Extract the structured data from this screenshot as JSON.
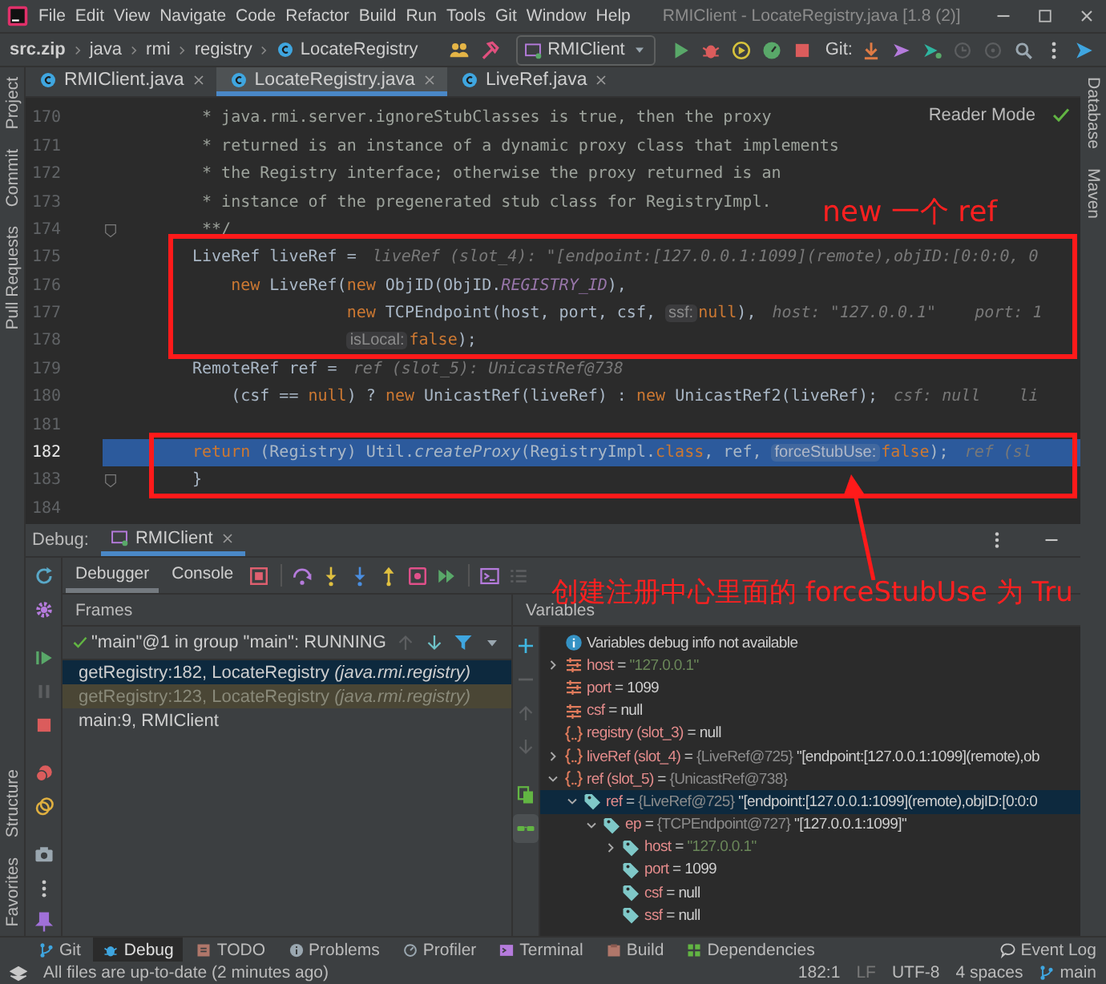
{
  "window": {
    "title": "RMIClient - LocateRegistry.java [1.8 (2)]"
  },
  "menu": [
    "File",
    "Edit",
    "View",
    "Navigate",
    "Code",
    "Refactor",
    "Build",
    "Run",
    "Tools",
    "Git",
    "Window",
    "Help"
  ],
  "breadcrumbs": [
    {
      "text": "src.zip",
      "kind": "archive"
    },
    {
      "text": "java",
      "kind": "package"
    },
    {
      "text": "rmi",
      "kind": "package"
    },
    {
      "text": "registry",
      "kind": "package"
    },
    {
      "text": "LocateRegistry",
      "kind": "class"
    }
  ],
  "toolbar": [
    {
      "kind": "users",
      "disabled": false
    },
    {
      "kind": "hammer",
      "disabled": false
    },
    {
      "kind": "run-config",
      "label": "RMIClient"
    },
    {
      "kind": "run",
      "disabled": false
    },
    {
      "kind": "debug",
      "disabled": false
    },
    {
      "kind": "coverage",
      "disabled": false
    },
    {
      "kind": "profiler",
      "disabled": false
    },
    {
      "kind": "stop",
      "disabled": false
    },
    {
      "kind": "git-label",
      "label": "Git:"
    },
    {
      "kind": "update",
      "disabled": false
    },
    {
      "kind": "push",
      "disabled": false
    },
    {
      "kind": "commit",
      "disabled": false
    },
    {
      "kind": "history",
      "disabled": true
    },
    {
      "kind": "rollback",
      "disabled": true
    },
    {
      "kind": "search",
      "disabled": false
    },
    {
      "kind": "more",
      "disabled": false
    },
    {
      "kind": "plugin",
      "disabled": false
    }
  ],
  "left_stripe": {
    "top": [
      "Project",
      "Commit",
      "Pull Requests"
    ],
    "bottom": [
      "Structure",
      "Favorites"
    ]
  },
  "right_stripe": [
    "Database",
    "Maven"
  ],
  "editor_tabs": [
    {
      "label": "RMIClient.java",
      "selected": false
    },
    {
      "label": "LocateRegistry.java",
      "selected": true
    },
    {
      "label": "LiveRef.java",
      "selected": false
    }
  ],
  "reader_mode": "Reader Mode",
  "code_lines": [
    {
      "number": "170",
      "kind": "statement",
      "current": false,
      "fold": false,
      "segments": [
        {
          "kind": "code",
          "parts": [
            {
              "kind": "comment",
              "text": " * java.rmi.server.ignoreStubClasses is true, then the proxy"
            }
          ]
        }
      ]
    },
    {
      "number": "171",
      "kind": "statement",
      "current": false,
      "fold": false,
      "segments": [
        {
          "kind": "code",
          "parts": [
            {
              "kind": "comment",
              "text": " * returned is an instance of a dynamic proxy class that implements"
            }
          ]
        }
      ]
    },
    {
      "number": "172",
      "kind": "statement",
      "current": false,
      "fold": false,
      "segments": [
        {
          "kind": "code",
          "parts": [
            {
              "kind": "comment",
              "text": " * the Registry interface; otherwise the proxy returned is an"
            }
          ]
        }
      ]
    },
    {
      "number": "173",
      "kind": "statement",
      "current": false,
      "fold": false,
      "segments": [
        {
          "kind": "code",
          "parts": [
            {
              "kind": "comment",
              "text": " * instance of the pregenerated stub class for RegistryImpl."
            }
          ]
        }
      ]
    },
    {
      "number": "174",
      "kind": "statement",
      "current": false,
      "fold": true,
      "segments": [
        {
          "kind": "code",
          "parts": [
            {
              "kind": "comment",
              "text": " **/"
            }
          ]
        }
      ]
    },
    {
      "number": "175",
      "kind": "statement",
      "current": false,
      "fold": false,
      "segments": [
        {
          "kind": "code",
          "parts": [
            {
              "kind": "plain",
              "text": "LiveRef liveRef ="
            }
          ]
        },
        {
          "kind": "hint",
          "text": "liveRef (slot_4): \"[endpoint:[127.0.0.1:1099](remote),objID:[0:0:0, 0"
        }
      ]
    },
    {
      "number": "176",
      "kind": "continuation",
      "current": false,
      "fold": false,
      "segments": [
        {
          "kind": "code",
          "parts": [
            {
              "kind": "keyword",
              "text": "new"
            },
            {
              "kind": "plain",
              "text": " LiveRef("
            },
            {
              "kind": "keyword",
              "text": "new"
            },
            {
              "kind": "plain",
              "text": " ObjID(ObjID."
            },
            {
              "kind": "static",
              "text": "REGISTRY_ID"
            },
            {
              "kind": "plain",
              "text": "),"
            }
          ]
        }
      ]
    },
    {
      "number": "177",
      "kind": "argument",
      "current": false,
      "fold": false,
      "segments": [
        {
          "kind": "code",
          "parts": [
            {
              "kind": "keyword",
              "text": "new"
            },
            {
              "kind": "plain",
              "text": " TCPEndpoint(host, port, csf, "
            }
          ]
        },
        {
          "kind": "inlay",
          "text": "ssf:"
        },
        {
          "kind": "code",
          "parts": [
            {
              "kind": "keyword",
              "text": "null"
            },
            {
              "kind": "plain",
              "text": "),"
            }
          ]
        },
        {
          "kind": "hint",
          "text": "host: \"127.0.0.1\"    port: 1"
        }
      ]
    },
    {
      "number": "178",
      "kind": "argument",
      "current": false,
      "fold": false,
      "segments": [
        {
          "kind": "inlay",
          "text": "isLocal:"
        },
        {
          "kind": "code",
          "parts": [
            {
              "kind": "keyword",
              "text": "false"
            },
            {
              "kind": "plain",
              "text": ");"
            }
          ]
        }
      ]
    },
    {
      "number": "179",
      "kind": "statement",
      "current": false,
      "fold": false,
      "segments": [
        {
          "kind": "code",
          "parts": [
            {
              "kind": "plain",
              "text": "RemoteRef ref ="
            }
          ]
        },
        {
          "kind": "hint",
          "text": "ref (slot_5): UnicastRef@738"
        }
      ]
    },
    {
      "number": "180",
      "kind": "continuation",
      "current": false,
      "fold": false,
      "segments": [
        {
          "kind": "code",
          "parts": [
            {
              "kind": "plain",
              "text": "(csf == "
            },
            {
              "kind": "keyword",
              "text": "null"
            },
            {
              "kind": "plain",
              "text": ") ? "
            },
            {
              "kind": "keyword",
              "text": "new"
            },
            {
              "kind": "plain",
              "text": " UnicastRef(liveRef) : "
            },
            {
              "kind": "keyword",
              "text": "new"
            },
            {
              "kind": "plain",
              "text": " UnicastRef2(liveRef);"
            }
          ]
        },
        {
          "kind": "hint",
          "text": "csf: null    li"
        }
      ]
    },
    {
      "number": "181",
      "kind": "statement",
      "current": false,
      "fold": false
    },
    {
      "number": "182",
      "kind": "statement",
      "current": true,
      "fold": false,
      "segments": [
        {
          "kind": "code",
          "parts": [
            {
              "kind": "keyword",
              "text": "return"
            },
            {
              "kind": "plain",
              "text": " (Registry) Util."
            },
            {
              "kind": "method",
              "text": "createProxy"
            },
            {
              "kind": "plain",
              "text": "(RegistryImpl."
            },
            {
              "kind": "keyword",
              "text": "class"
            },
            {
              "kind": "plain",
              "text": ", ref, "
            }
          ]
        },
        {
          "kind": "inlay",
          "text": "forceStubUse:"
        },
        {
          "kind": "code",
          "parts": [
            {
              "kind": "keyword",
              "text": "false"
            },
            {
              "kind": "plain",
              "text": ");"
            }
          ]
        },
        {
          "kind": "hint",
          "text": "ref (sl"
        }
      ]
    },
    {
      "number": "183",
      "kind": "statement",
      "current": false,
      "fold": true,
      "segments": [
        {
          "kind": "code",
          "parts": [
            {
              "kind": "plain",
              "text": "}"
            }
          ]
        }
      ]
    },
    {
      "number": "184",
      "kind": "statement",
      "current": false,
      "fold": false
    }
  ],
  "annotations": [
    {
      "text": "new 一个 ref"
    },
    {
      "text": "创建注册中心里面的 forceStubUse 为 Tru"
    }
  ],
  "debug": {
    "label": "Debug:",
    "session_tab": "RMIClient",
    "left_tools": [
      {
        "kind": "rerun",
        "disabled": false
      },
      {
        "kind": "settings",
        "disabled": false
      },
      {
        "kind": "resume",
        "disabled": false
      },
      {
        "kind": "pause",
        "disabled": true
      },
      {
        "kind": "stop",
        "disabled": false
      },
      {
        "kind": "breakpoints",
        "disabled": false
      },
      {
        "kind": "mute",
        "disabled": false
      },
      {
        "kind": "camera",
        "disabled": false
      },
      {
        "kind": "more-v",
        "disabled": false
      },
      {
        "kind": "pin",
        "disabled": false
      }
    ],
    "tabs": [
      {
        "label": "Debugger",
        "selected": true
      },
      {
        "label": "Console",
        "selected": false
      }
    ],
    "toolbar": [
      {
        "kind": "layout",
        "disabled": false
      },
      {
        "kind": "step-over",
        "disabled": false
      },
      {
        "kind": "step-into",
        "disabled": false
      },
      {
        "kind": "force-step-into",
        "disabled": false
      },
      {
        "kind": "step-out",
        "disabled": false
      },
      {
        "kind": "drop-frame",
        "disabled": false
      },
      {
        "kind": "run-to-cursor",
        "disabled": false
      },
      {
        "kind": "evaluate",
        "disabled": false
      },
      {
        "kind": "trace",
        "disabled": true
      }
    ],
    "frames": {
      "title": "Frames",
      "thread": "\"main\"@1 in group \"main\": RUNNING",
      "thread_tools": [
        {
          "kind": "up",
          "disabled": true
        },
        {
          "kind": "down",
          "disabled": false
        },
        {
          "kind": "filter",
          "disabled": false
        },
        {
          "kind": "caret",
          "disabled": false
        }
      ],
      "items": [
        {
          "text": "getRegistry:182, LocateRegistry *(java.rmi.registry)*",
          "selected": true,
          "library": false
        },
        {
          "text": "getRegistry:123, LocateRegistry *(java.rmi.registry)*",
          "selected": false,
          "library": true
        },
        {
          "text": "main:9, RMIClient",
          "selected": false,
          "library": false
        }
      ]
    },
    "variables": {
      "title": "Variables",
      "tools": [
        {
          "kind": "add",
          "disabled": false,
          "selected": false
        },
        {
          "kind": "remove",
          "disabled": true,
          "selected": false
        },
        {
          "kind": "up",
          "disabled": true,
          "selected": false
        },
        {
          "kind": "down",
          "disabled": true,
          "selected": false
        },
        {
          "kind": "copy",
          "disabled": false,
          "selected": false
        },
        {
          "kind": "glasses",
          "disabled": false,
          "selected": true
        }
      ],
      "items": [
        {
          "kind": "info",
          "name": "Variables debug info not available",
          "selected": false
        },
        {
          "kind": "param",
          "name": "host",
          "op": "=",
          "value": "\"127.0.0.1\"",
          "is_string": true,
          "expanded": false,
          "selected": false
        },
        {
          "kind": "param",
          "name": "port",
          "op": "=",
          "value": "1099",
          "is_string": false,
          "selected": false
        },
        {
          "kind": "param",
          "name": "csf",
          "op": "=",
          "value": "null",
          "is_string": false,
          "selected": false
        },
        {
          "kind": "local",
          "name": "registry (slot_3)",
          "op": "=",
          "value": "null",
          "is_string": false,
          "selected": false
        },
        {
          "kind": "local",
          "name": "liveRef (slot_4)",
          "op": "=",
          "type": "{LiveRef@725}",
          "value": "\"[endpoint:[127.0.0.1:1099](remote),ob",
          "is_string": false,
          "expanded": false,
          "selected": false
        },
        {
          "kind": "local",
          "name": "ref (slot_5)",
          "op": "=",
          "type": "{UnicastRef@738}",
          "expanded": true,
          "selected": false,
          "children": [
            {
              "kind": "field",
              "name": "ref",
              "op": "=",
              "type": "{LiveRef@725}",
              "value": "\"[endpoint:[127.0.0.1:1099](remote),objID:[0:0:0",
              "is_string": false,
              "expanded": true,
              "selected": true,
              "children": [
                {
                  "kind": "field",
                  "name": "ep",
                  "op": "=",
                  "type": "{TCPEndpoint@727}",
                  "value": "\"[127.0.0.1:1099]\"",
                  "is_string": false,
                  "expanded": true,
                  "selected": false,
                  "children": [
                    {
                      "kind": "field",
                      "name": "host",
                      "op": "=",
                      "value": "\"127.0.0.1\"",
                      "is_string": true,
                      "expanded": false,
                      "selected": false
                    },
                    {
                      "kind": "field",
                      "name": "port",
                      "op": "=",
                      "value": "1099",
                      "is_string": false,
                      "selected": false
                    },
                    {
                      "kind": "field",
                      "name": "csf",
                      "op": "=",
                      "value": "null",
                      "is_string": false,
                      "selected": false
                    },
                    {
                      "kind": "field",
                      "name": "ssf",
                      "op": "=",
                      "value": "null",
                      "is_string": false,
                      "selected": false
                    }
                  ]
                }
              ]
            }
          ]
        }
      ]
    }
  },
  "tool_windows": [
    {
      "label": "Git",
      "kind": "git",
      "selected": false
    },
    {
      "label": "Debug",
      "kind": "debug",
      "selected": true
    },
    {
      "label": "TODO",
      "kind": "todo",
      "selected": false
    },
    {
      "label": "Problems",
      "kind": "problems",
      "selected": false
    },
    {
      "label": "Profiler",
      "kind": "profiler",
      "selected": false
    },
    {
      "label": "Terminal",
      "kind": "terminal",
      "selected": false
    },
    {
      "label": "Build",
      "kind": "build",
      "selected": false
    },
    {
      "label": "Dependencies",
      "kind": "dependencies",
      "selected": false
    }
  ],
  "event_log": "Event Log",
  "status_bar": {
    "message": "All files are up-to-date (2 minutes ago)",
    "position": "182:1",
    "line_separator": "LF",
    "encoding": "UTF-8",
    "indent": "4 spaces",
    "branch": "main"
  }
}
